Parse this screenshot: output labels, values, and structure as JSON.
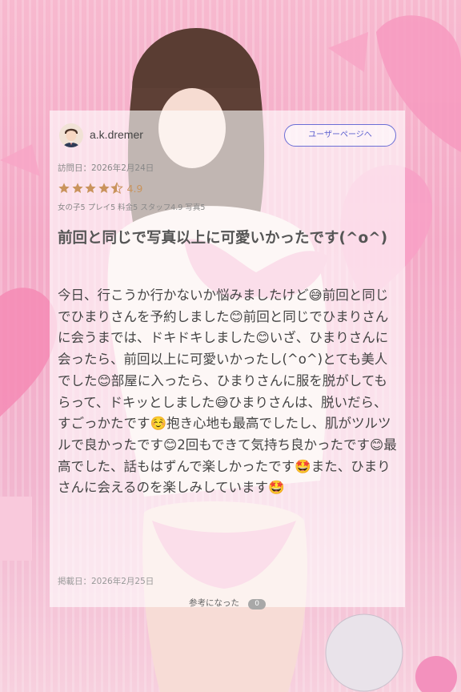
{
  "review": {
    "username": "a.k.dremer",
    "user_page_button": "ユーザーページへ",
    "visit_date": "訪問日：2026年2月24日",
    "rating": {
      "stars": 4.9,
      "score_text": "4.9",
      "subscores": "女の子5 プレイ5 料金5 スタッフ4.9 写真5"
    },
    "title": "前回と同じで写真以上に可愛いかったです(^o^)",
    "body": "今日、行こうか行かないか悩みましたけど😅前回と同じでひまりさんを予約しました😊前回と同じでひまりさんに会うまでは、ドキドキしました😊いざ、ひまりさんに会ったら、前回以上に可愛いかったし(^o^)とても美人でした😊部屋に入ったら、ひまりさんに服を脱がしてもらって、ドキッとしました😅ひまりさんは、脱いだら、すごっかたです☺️抱き心地も最高でしたし、肌がツルツルで良かったです😊2回もできて気持ち良かったです😊最高でした、話もはずんで楽しかったです🤩また、ひまりさんに会えるのを楽しみしています🤩",
    "posted_date": "掲載日：2026年2月25日",
    "helpful_label": "参考になった",
    "helpful_count": "0"
  },
  "icons": {
    "avatar": "user-avatar-icon",
    "star": "star-icon"
  },
  "colors": {
    "star": "#c9935c",
    "button_border": "#6b6fd6",
    "background_pink": "#f4a9c6"
  }
}
